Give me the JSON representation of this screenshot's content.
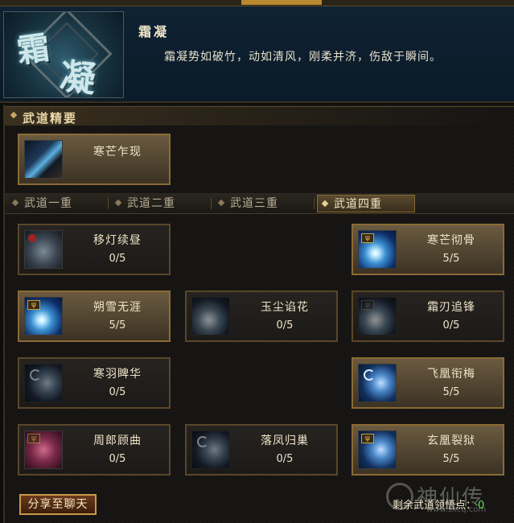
{
  "header": {
    "title": "霜凝",
    "description": "霜凝势如破竹，动如清风，刚柔并济，伤敌于瞬间。",
    "emblem_chars": [
      "霜",
      "凝"
    ]
  },
  "section": {
    "title": "武道精要"
  },
  "essence": {
    "name": "寒芒乍现",
    "icon": "sword-slash-icon"
  },
  "tabs": [
    {
      "label": "武道一重",
      "active": false
    },
    {
      "label": "武道二重",
      "active": false
    },
    {
      "label": "武道三重",
      "active": false
    },
    {
      "label": "武道四重",
      "active": true
    }
  ],
  "skills": [
    {
      "name": "移灯续昼",
      "value": "0/5",
      "icon": "footstep-icon",
      "lit": false
    },
    {
      "name": "寒芒彻骨",
      "value": "5/5",
      "icon": "ice-burst-icon",
      "lit": true
    },
    {
      "name": "朔雪无涯",
      "value": "5/5",
      "icon": "ice-burst-icon",
      "lit": true
    },
    {
      "name": "玉尘谄花",
      "value": "0/5",
      "icon": "ice-burst-icon",
      "lit": false
    },
    {
      "name": "霜刃追锋",
      "value": "0/5",
      "icon": "ice-burst-icon",
      "lit": false
    },
    {
      "name": "寒羽睥华",
      "value": "0/5",
      "icon": "moon-wave-icon",
      "lit": false
    },
    {
      "name": "飞凰衔梅",
      "value": "5/5",
      "icon": "moon-wave-icon",
      "lit": true
    },
    {
      "name": "周郎顾曲",
      "value": "0/5",
      "icon": "rose-icon",
      "lit": false
    },
    {
      "name": "落凤归巢",
      "value": "0/5",
      "icon": "moon-wave-icon",
      "lit": false
    },
    {
      "name": "玄凰裂狱",
      "value": "5/5",
      "icon": "moon-wave-icon",
      "lit": true
    }
  ],
  "share_button": "分享至聊天",
  "points": {
    "label": "剩余武道领悟点：",
    "value": "0"
  },
  "watermark": {
    "text": "神仙传",
    "url": "www.sxcq.com"
  },
  "colors": {
    "accent_gold": "#c89a4a",
    "points_green": "#58e058"
  }
}
